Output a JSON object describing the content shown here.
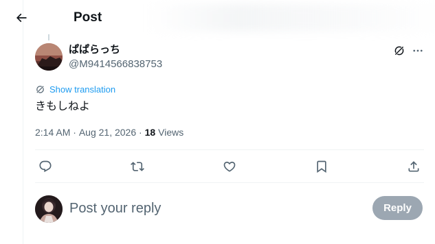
{
  "header": {
    "title": "Post"
  },
  "post": {
    "author": {
      "display_name": "ぱぱらっち",
      "handle": "@M9414566838753"
    },
    "translate_label": "Show translation",
    "text": "きもしねよ",
    "meta": {
      "time": "2:14 AM",
      "separator": " · ",
      "date": "Aug 21, 2026",
      "separator2": " · ",
      "views_count": "18",
      "views_label": "Views"
    }
  },
  "reply_box": {
    "placeholder": "Post your reply",
    "button_label": "Reply"
  },
  "icons": {
    "back": "arrow-left-icon",
    "grok": "grok-icon",
    "more": "more-dots-icon",
    "translate": "globe-translate-icon",
    "reply": "comment-icon",
    "repost": "repost-icon",
    "like": "heart-icon",
    "bookmark": "bookmark-icon",
    "share": "share-icon"
  },
  "colors": {
    "accent": "#1d9bf0",
    "text_primary": "#0f1419",
    "text_secondary": "#536471",
    "reply_button_disabled": "#8b98a5"
  }
}
